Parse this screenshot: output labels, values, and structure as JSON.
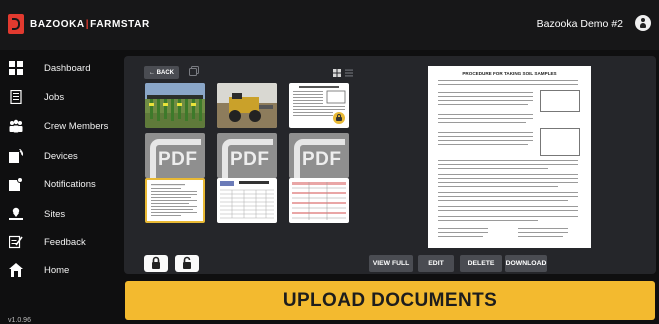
{
  "header": {
    "brand_left": "BAZOOKA",
    "brand_right": "FARMSTAR",
    "user_name": "Bazooka Demo #2"
  },
  "sidebar": {
    "items": [
      {
        "label": "Dashboard",
        "icon": "dashboard-icon"
      },
      {
        "label": "Jobs",
        "icon": "jobs-icon"
      },
      {
        "label": "Crew Members",
        "icon": "crew-members-icon"
      },
      {
        "label": "Devices",
        "icon": "devices-icon"
      },
      {
        "label": "Notifications",
        "icon": "notifications-icon"
      },
      {
        "label": "Sites",
        "icon": "sites-icon"
      },
      {
        "label": "Feedback",
        "icon": "feedback-icon"
      },
      {
        "label": "Home",
        "icon": "home-icon"
      }
    ],
    "version": "v1.0.96"
  },
  "documents": {
    "back_label": "← BACK",
    "pdf_label": "PDF",
    "items": [
      {
        "kind": "photo-field-equipment"
      },
      {
        "kind": "photo-machine"
      },
      {
        "kind": "document",
        "locked": true
      },
      {
        "kind": "pdf"
      },
      {
        "kind": "pdf"
      },
      {
        "kind": "pdf"
      },
      {
        "kind": "document-doc",
        "selected": true
      },
      {
        "kind": "spreadsheet"
      },
      {
        "kind": "table-sheet"
      }
    ]
  },
  "preview": {
    "title": "PROCEDURE FOR TAKING SOIL SAMPLES"
  },
  "actions": {
    "view_full": "VIEW FULL",
    "edit": "EDIT",
    "delete": "DELETE",
    "download": "DOWNLOAD"
  },
  "upload": {
    "label": "UPLOAD DOCUMENTS"
  },
  "colors": {
    "accent": "#f3ba2f",
    "brand_red": "#e23a2f",
    "panel": "#25262a",
    "background": "#0f0f10",
    "button": "#4a4c52"
  }
}
